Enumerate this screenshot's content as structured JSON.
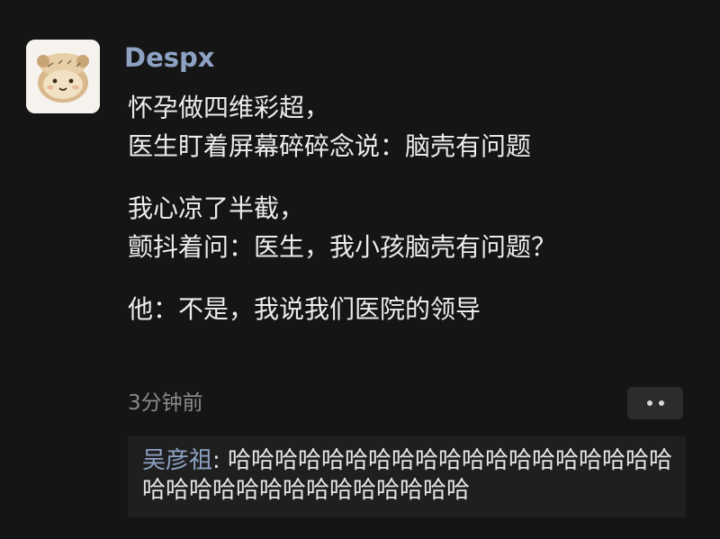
{
  "post": {
    "username": "Despx",
    "avatar_icon": "bear-face-icon",
    "paragraphs": [
      {
        "lines": [
          "怀孕做四维彩超，",
          "医生盯着屏幕碎碎念说：脑壳有问题"
        ]
      },
      {
        "lines": [
          "我心凉了半截，",
          "颤抖着问：医生，我小孩脑壳有问题？"
        ]
      },
      {
        "lines": [
          "他：不是，我说我们医院的领导"
        ]
      }
    ],
    "timestamp": "3分钟前",
    "more_icon": "more-dots-icon"
  },
  "comments": [
    {
      "author": "吴彦祖",
      "separator": ": ",
      "text": "哈哈哈哈哈哈哈哈哈哈哈哈哈哈哈哈哈哈哈哈哈哈哈哈哈哈哈哈哈哈哈哈哈"
    }
  ],
  "colors": {
    "background": "#151515",
    "username": "#8ea3c4",
    "text": "#ececec",
    "timestamp": "#8a8a8a",
    "comment_box": "#1f1f1f"
  }
}
